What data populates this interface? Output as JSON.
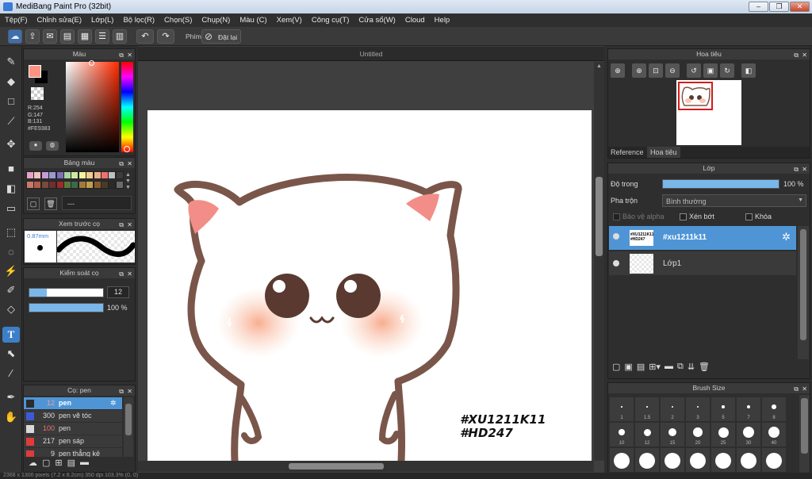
{
  "window": {
    "title": "MediBang Paint Pro (32bit)"
  },
  "menu": [
    "Tệp(F)",
    "Chỉnh sửa(E)",
    "Lớp(L)",
    "Bộ lọc(R)",
    "Chọn(S)",
    "Chụp(N)",
    "Màu (C)",
    "Xem(V)",
    "Công cụ(T)",
    "Cửa sổ(W)",
    "Cloud",
    "Help"
  ],
  "toolbar": {
    "shortcut_label": "Phím",
    "reset_label": "Đặt lại"
  },
  "color_panel": {
    "title": "Màu",
    "r": "R:254",
    "g": "G:147",
    "b": "B:131",
    "hex": "#FE9383",
    "fg_color": "#fe9383"
  },
  "palette_panel": {
    "title": "Bảng màu",
    "name": "---",
    "colors": [
      "#e6a3c7",
      "#f4c2c2",
      "#c69bd6",
      "#9a9ad0",
      "#7f6fb5",
      "#a8d5a3",
      "#cfe8a0",
      "#f6f2a0",
      "#f3cc90",
      "#eab08a",
      "#f07070",
      "#bfbfbf",
      "#3c3c3c",
      "#c97a6b",
      "#b65e4b",
      "#7a4b3a",
      "#6e2f2f",
      "#9c2b2b",
      "#5a7a3a",
      "#3a6a4a",
      "#a07a3a",
      "#c0a050",
      "#8a5a2a",
      "#4a3a2a",
      "#2a2a2a",
      "#6a6a6a"
    ]
  },
  "brush_preview_panel": {
    "title": "Xem trước cọ",
    "size": "0.87mm"
  },
  "brush_control_panel": {
    "title": "Kiểm soát cọ",
    "size_value": "12",
    "opacity_value": "100 %",
    "size_fraction": 0.12,
    "opacity_fraction": 1.0
  },
  "brush_panel": {
    "title": "Cọ: pen",
    "items": [
      {
        "num": "12",
        "name": "pen",
        "color": "#2c2c2c"
      },
      {
        "num": "300",
        "name": "pen vẽ tóc",
        "color": "#3b5bd6"
      },
      {
        "num": "100",
        "name": "pen",
        "color": "#d9d9d9"
      },
      {
        "num": "217",
        "name": "pen sáp",
        "color": "#e03b3b"
      },
      {
        "num": "9",
        "name": "pen thẳng kẻ",
        "color": "#e03b3b"
      }
    ]
  },
  "document": {
    "tab": "Untitled",
    "watermark_line1": "#XU1211K11",
    "watermark_line2": "#HD247"
  },
  "navigator_panel": {
    "title": "Hoa tiêu",
    "tab_reference": "Reference",
    "tab_navigator": "Hoa tiêu"
  },
  "layer_panel": {
    "title": "Lớp",
    "opacity_label": "Độ trong",
    "opacity_value": "100 %",
    "opacity_fraction": 1.0,
    "blend_label": "Pha trộn",
    "blend_value": "Bình thường",
    "protect_alpha": "Bảo vệ alpha",
    "clipping": "Xén bớt",
    "lock": "Khóa",
    "layers": [
      {
        "name": "#xu1211k11",
        "selected": true
      },
      {
        "name": "Lớp1",
        "selected": false
      }
    ]
  },
  "brush_size_panel": {
    "title": "Brush Size",
    "row1": [
      "1",
      "1.5",
      "2",
      "3",
      "5",
      "7",
      "8"
    ],
    "row2": [
      "10",
      "12",
      "15",
      "20",
      "25",
      "30",
      "40"
    ]
  },
  "status": "2368 x 1300 pixels (7.2 x 8.2cm) 350 dpi 103.3% (0, 0)"
}
